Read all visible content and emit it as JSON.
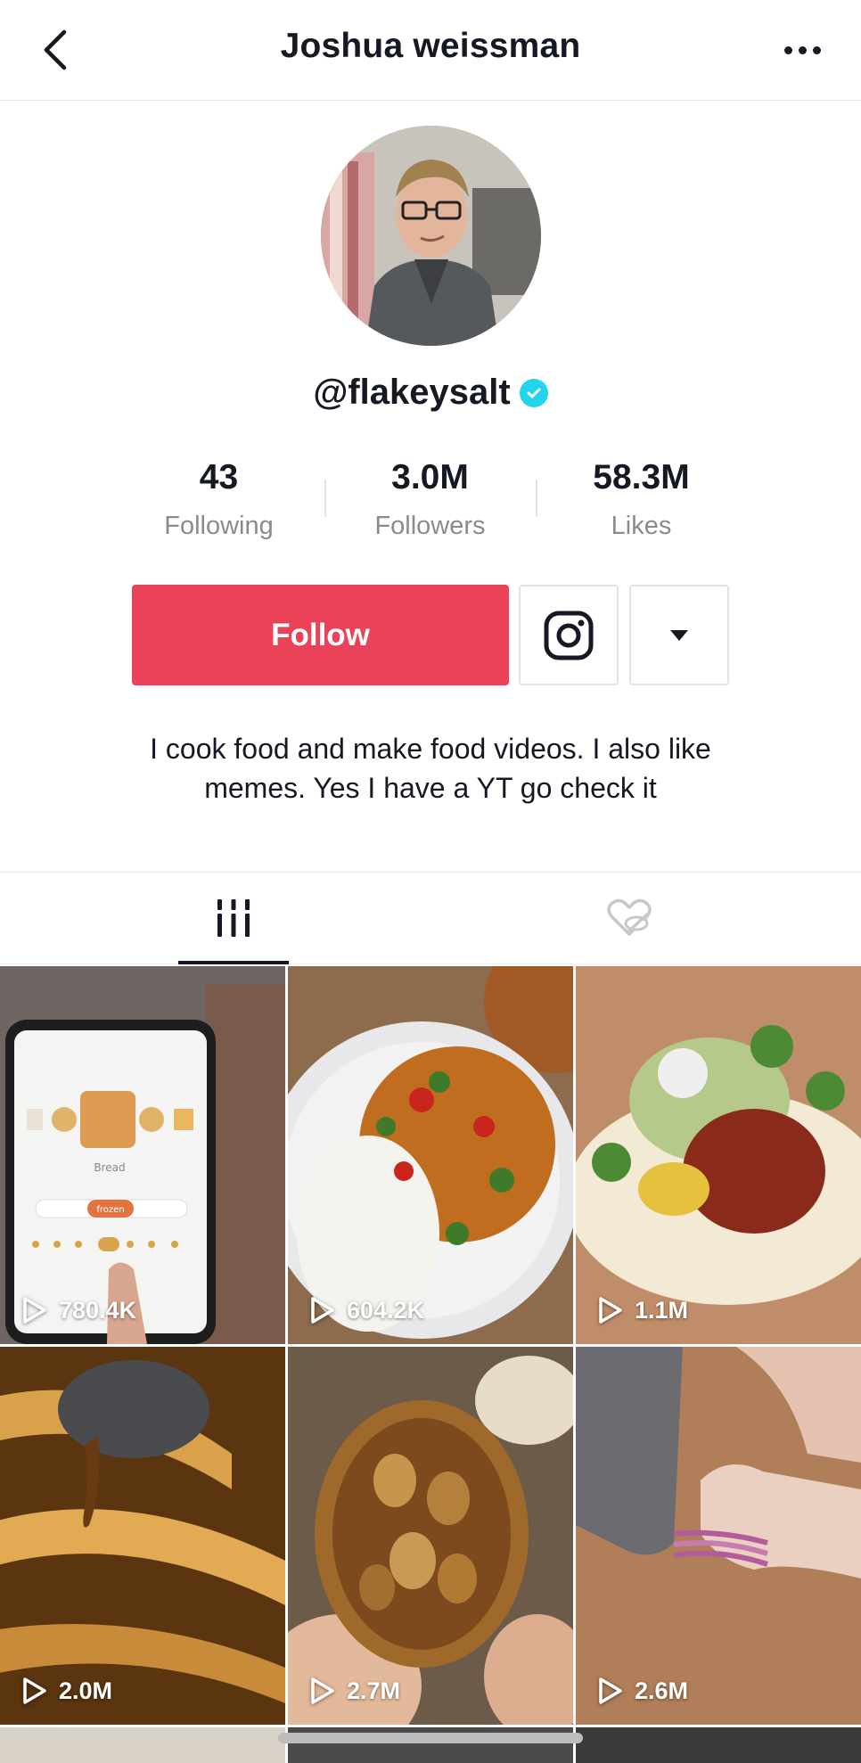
{
  "header": {
    "title": "Joshua weissman",
    "back_icon": "chevron-left-icon",
    "more_icon": "more-horizontal-icon"
  },
  "profile": {
    "handle": "@flakeysalt",
    "verified_icon": "verified-check-icon",
    "verified_color": "#20d5ec"
  },
  "stats": [
    {
      "value": "43",
      "label": "Following"
    },
    {
      "value": "3.0M",
      "label": "Followers"
    },
    {
      "value": "58.3M",
      "label": "Likes"
    }
  ],
  "actions": {
    "follow_label": "Follow",
    "follow_color": "#ea4359",
    "instagram_icon": "instagram-icon",
    "dropdown_icon": "caret-down-icon"
  },
  "bio": {
    "line1": "I cook food and make food videos. I also like",
    "line2": "memes. Yes I have a YT go check it"
  },
  "tabs": [
    {
      "name": "videos",
      "icon": "grid-videos-icon",
      "active": true
    },
    {
      "name": "liked",
      "icon": "liked-private-icon",
      "active": false
    }
  ],
  "videos": [
    {
      "views": "780.4K",
      "subject": "bread maker screen"
    },
    {
      "views": "604.2K",
      "subject": "curry with rice"
    },
    {
      "views": "1.1M",
      "subject": "taco"
    },
    {
      "views": "2.0M",
      "subject": "glazed bananas"
    },
    {
      "views": "2.7M",
      "subject": "roasted garlic"
    },
    {
      "views": "2.6M",
      "subject": "sliced shallot"
    }
  ]
}
